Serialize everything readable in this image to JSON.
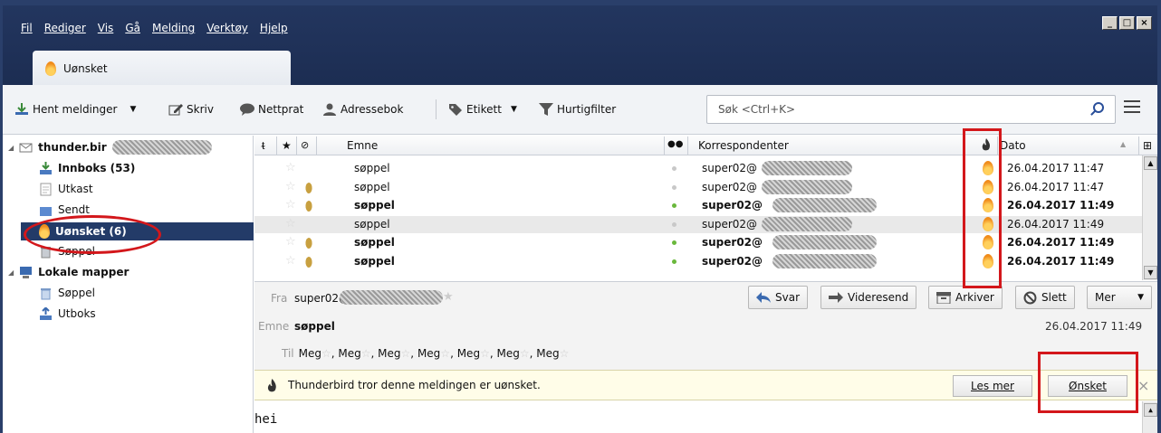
{
  "menu": [
    "Fil",
    "Rediger",
    "Vis",
    "Gå",
    "Melding",
    "Verktøy",
    "Hjelp"
  ],
  "window_controls": [
    "_",
    "□",
    "×"
  ],
  "tab": {
    "label": "Uønsket",
    "icon": "flame-icon"
  },
  "toolbar": {
    "get_messages": "Hent meldinger",
    "write": "Skriv",
    "chat": "Nettprat",
    "address_book": "Adressebok",
    "tag": "Etikett",
    "quick_filter": "Hurtigfilter",
    "search_placeholder": "Søk <Ctrl+K>"
  },
  "folders": [
    {
      "label": "thunder.bir",
      "level": 0,
      "icon": "account-icon",
      "bold": true
    },
    {
      "label": "Innboks (53)",
      "level": 1,
      "icon": "inbox-icon",
      "bold": true
    },
    {
      "label": "Utkast",
      "level": 1,
      "icon": "drafts-icon",
      "bold": false
    },
    {
      "label": "Sendt",
      "level": 1,
      "icon": "sent-icon",
      "bold": false
    },
    {
      "label": "Uønsket (6)",
      "level": 1,
      "icon": "junk-flame-icon",
      "bold": true,
      "selected": true
    },
    {
      "label": "Søppel",
      "level": 1,
      "icon": "trash-icon",
      "bold": false
    },
    {
      "label": "Lokale mapper",
      "level": 0,
      "icon": "local-folders-icon",
      "bold": true
    },
    {
      "label": "Søppel",
      "level": 1,
      "icon": "trash-icon",
      "bold": false
    },
    {
      "label": "Utboks",
      "level": 1,
      "icon": "outbox-icon",
      "bold": false
    }
  ],
  "columns": {
    "subject": "Emne",
    "correspondents": "Korrespondenter",
    "date": "Dato"
  },
  "messages": [
    {
      "subject": "søppel",
      "from": "super02@",
      "date": "26.04.2017 11:47",
      "bold": false,
      "attachment": false,
      "read": true
    },
    {
      "subject": "søppel",
      "from": "super02@",
      "date": "26.04.2017 11:47",
      "bold": false,
      "attachment": true,
      "read": true
    },
    {
      "subject": "søppel",
      "from": "super02@",
      "date": "26.04.2017 11:49",
      "bold": true,
      "attachment": true,
      "read": false
    },
    {
      "subject": "søppel",
      "from": "super02@",
      "date": "26.04.2017 11:49",
      "bold": false,
      "attachment": false,
      "read": true,
      "highlighted": true
    },
    {
      "subject": "søppel",
      "from": "super02@",
      "date": "26.04.2017 11:49",
      "bold": true,
      "attachment": true,
      "read": false
    },
    {
      "subject": "søppel",
      "from": "super02@",
      "date": "26.04.2017 11:49",
      "bold": true,
      "attachment": true,
      "read": false
    }
  ],
  "header": {
    "from_label": "Fra",
    "from_value": "super02@",
    "subject_label": "Emne",
    "subject_value": "søppel",
    "date": "26.04.2017 11:49",
    "to_label": "Til",
    "to_values": [
      "Meg",
      "Meg",
      "Meg",
      "Meg",
      "Meg",
      "Meg",
      "Meg"
    ],
    "reply": "Svar",
    "forward": "Videresend",
    "archive": "Arkiver",
    "delete": "Slett",
    "more": "Mer"
  },
  "notification": {
    "text": "Thunderbird tror denne meldingen er uønsket.",
    "learn_more": "Les mer",
    "not_junk": "Ønsket",
    "close": "×"
  },
  "body_text": "hei",
  "colors": {
    "titlebar": "#1c2d52",
    "selected_folder": "#233b68",
    "annotation_red": "#d3171b",
    "notification_bg": "#fffde8"
  }
}
